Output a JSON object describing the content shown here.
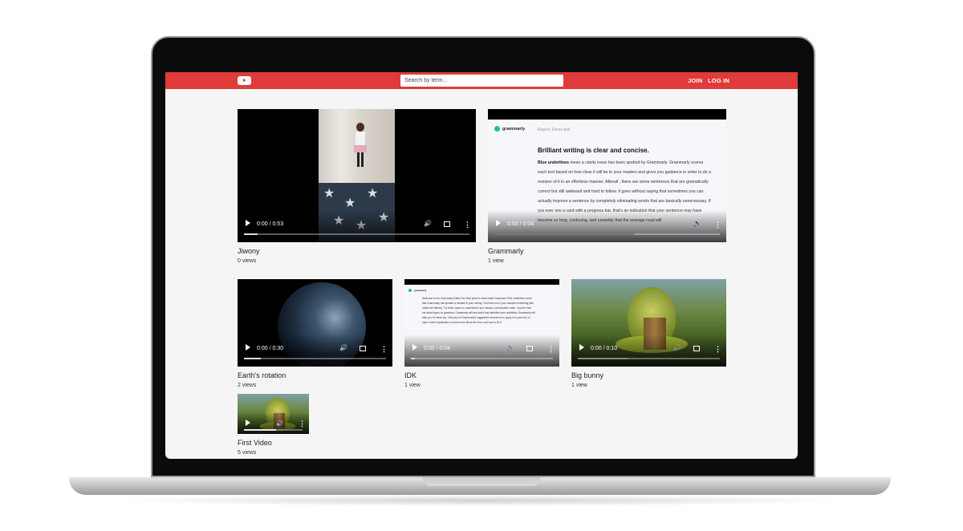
{
  "navbar": {
    "logo_icon": "youtube-play-icon",
    "search_placeholder": "Search by term...",
    "join_label": "JOIN",
    "login_label": "LOG IN",
    "accent_color": "#e03a3a"
  },
  "videos": [
    {
      "title": "Jiwony",
      "views": "0 views",
      "time": "0:00 / 0:53"
    },
    {
      "title": "Grammarly",
      "views": "1 view",
      "time": "0:00 / 0:04",
      "thumb_doc": {
        "brand": "grammarly",
        "report": "Report: Demo text",
        "heading": "Brilliant writing is clear and concise.",
        "lead": "Blue underlines",
        "body": "mean a clarity issue has been spotted by Grammarly. Grammarly scores each text based on how clear it will be to your readers and gives you guidance in order to do a revision of it in an effortless manner. Afterall , there are some sentences that are gramatically correct but still awkward and hard to follow. It goes without saying that sometimes you can actually improve a sentence by completely eliminating words that are basically unnecessary. If you ever see a card with a progress bar, that's an indication that your sentence may have become so long, confusing, and unwieldy that the average read will"
      }
    },
    {
      "title": "Earth's rotation",
      "views": "2 views",
      "time": "0:00 / 0:30"
    },
    {
      "title": "IDK",
      "views": "1 view",
      "time": "0:00 / 0:04",
      "thumb_doc": {
        "brand": "grammarly",
        "body": "Welcome to the Grammarly Editor, the best place to write what's important. Red underlines mean that Grammarly has spotted a mistake in your writing. You'll see one if you misspell something (like emali  rerrt lltered). Try three cases on underlines if you misuse a punctuation mark. If you're ever not about typos on grammar, Grammarly will see that it has identified your credibility. Grammarly will help you fix these too. Click any of Grammarly's suggested corrections to apply it to your text, or open a brief explanation to learn more about the error and how to fix it."
      }
    },
    {
      "title": "Big bunny",
      "views": "1 view",
      "time": "0:00 / 0:10"
    },
    {
      "title": "First Video",
      "views": "5 views",
      "time": ""
    }
  ],
  "controls": {
    "play_icon": "play-icon",
    "volume_icon": "volume-icon",
    "fullscreen_icon": "fullscreen-icon",
    "more_icon": "more-options-icon"
  }
}
